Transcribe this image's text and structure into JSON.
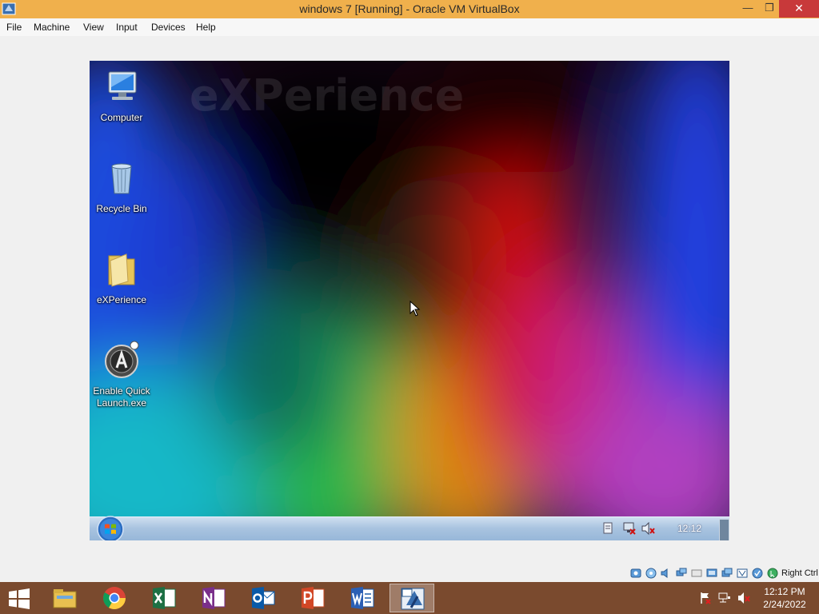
{
  "window": {
    "title": "windows 7 [Running] - Oracle VM VirtualBox"
  },
  "menu": [
    "File",
    "Machine",
    "View",
    "Input",
    "Devices",
    "Help"
  ],
  "guest": {
    "wallpaper_text": "eXPerience",
    "desktop_icons": [
      {
        "label": "Computer",
        "icon": "computer-icon"
      },
      {
        "label": "Recycle Bin",
        "icon": "recycle-bin-icon"
      },
      {
        "label": "eXPerience",
        "icon": "folder-icon"
      },
      {
        "label_line1": "Enable Quick",
        "label_line2": "Launch.exe",
        "icon": "quick-launch-icon"
      }
    ],
    "taskbar": {
      "clock": "12:12"
    }
  },
  "vbox_status": {
    "host_key": "Right Ctrl"
  },
  "host_taskbar": {
    "apps": [
      "File Explorer",
      "Google Chrome",
      "Excel",
      "OneNote",
      "Outlook",
      "PowerPoint",
      "Word",
      "VirtualBox"
    ],
    "time": "12:12 PM",
    "date": "2/24/2022"
  },
  "colors": {
    "titlebar": "#f0b04c",
    "close_button": "#c8393a",
    "host_taskbar": "#7a4a2e",
    "guest_taskbar": "#a9c4e0"
  }
}
